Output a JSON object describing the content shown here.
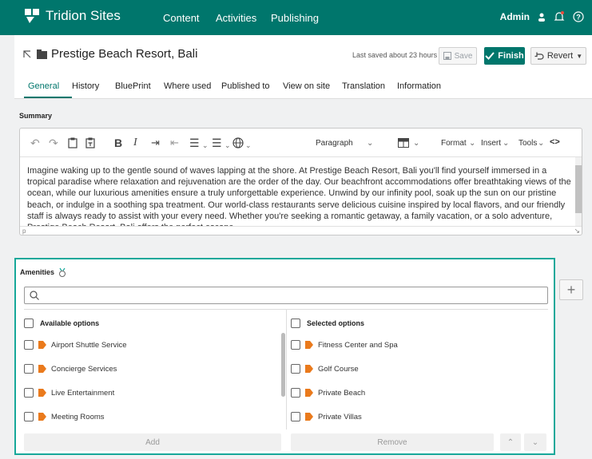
{
  "app": {
    "name": "Tridion Sites",
    "brand_color": "#00766c",
    "accent_border": "#17a89a",
    "tag_color": "#ea7a1c"
  },
  "nav": [
    "Content",
    "Activities",
    "Publishing"
  ],
  "user": {
    "name": "Admin",
    "user_icon": "user-icon",
    "bell_icon": "bell-icon",
    "help_icon": "help-icon"
  },
  "item": {
    "title": "Prestige Beach Resort, Bali",
    "last_saved": "Last saved about 23 hours"
  },
  "actions": {
    "save": "Save",
    "finish": "Finish",
    "revert": "Revert"
  },
  "tabs": [
    "General",
    "History",
    "BluePrint",
    "Where used",
    "Published to",
    "View on site",
    "Translation",
    "Information"
  ],
  "summary": {
    "label": "Summary",
    "paragraph_select": "Paragraph",
    "menus": {
      "format": "Format",
      "insert": "Insert",
      "tools": "Tools"
    },
    "text": "Imagine waking up to the gentle sound of waves lapping at the shore. At Prestige Beach Resort, Bali you'll find yourself immersed in a tropical paradise where relaxation and rejuvenation are the order of the day. Our beachfront accommodations offer breathtaking views of the ocean, while our luxurious amenities ensure a truly unforgettable experience. Unwind by our infinity pool, soak up the sun on our pristine beach, or indulge in a soothing spa treatment. Our world-class restaurants serve delicious cuisine inspired by local flavors, and our friendly staff is always ready to assist with your every need. Whether you're seeking a romantic getaway, a family vacation, or a solo adventure, Prestige Beach Resort, Bali offers the perfect escape.",
    "status_path": "p"
  },
  "amenities": {
    "label": "Amenities",
    "available_header": "Available options",
    "selected_header": "Selected options",
    "available": [
      "Airport Shuttle Service",
      "Concierge Services",
      "Live Entertainment",
      "Meeting Rooms"
    ],
    "selected": [
      "Fitness Center and Spa",
      "Golf Course",
      "Private Beach",
      "Private Villas"
    ],
    "add": "Add",
    "remove": "Remove"
  }
}
